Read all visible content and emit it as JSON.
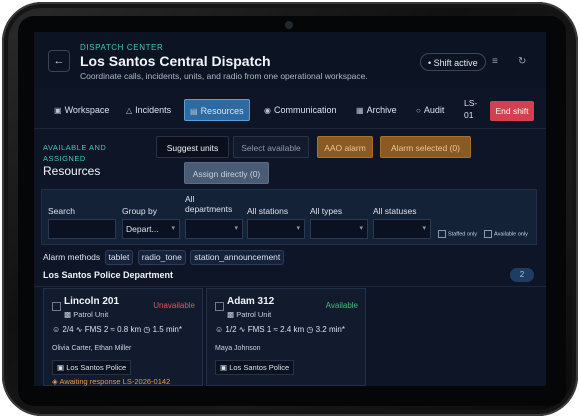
{
  "header": {
    "eyebrow": "DISPATCH CENTER",
    "title": "Los Santos Central Dispatch",
    "subtitle": "Coordinate calls, incidents, units, and radio from one operational workspace.",
    "shift_label": "Shift active"
  },
  "tabs": [
    {
      "label": "Workspace",
      "icon": "workspace-icon"
    },
    {
      "label": "Incidents",
      "icon": "incidents-icon"
    },
    {
      "label": "Resources",
      "icon": "resources-icon",
      "active": true
    },
    {
      "label": "Communication",
      "icon": "communication-icon"
    },
    {
      "label": "Archive",
      "icon": "archive-icon"
    },
    {
      "label": "Audit",
      "icon": "audit-icon"
    }
  ],
  "org_code": {
    "line1": "LS-",
    "line2": "01"
  },
  "end_shift_label": "End shift",
  "resources": {
    "eyebrow_line1": "AVAILABLE AND",
    "eyebrow_line2": "ASSIGNED",
    "title": "Resources",
    "actions": {
      "suggest": "Suggest units",
      "select_available": "Select available",
      "aao_alarm": "AAO alarm",
      "alarm_selected": "Alarm selected (0)",
      "assign_directly": "Assign directly (0)"
    }
  },
  "filters": {
    "search_label": "Search",
    "search_value": "",
    "group_by_label": "Group by",
    "group_by_value": "Depart...",
    "departments_label_line1": "All",
    "departments_label_line2": "departments",
    "departments_value": "",
    "stations_label": "All stations",
    "stations_value": "",
    "types_label": "All types",
    "types_value": "",
    "statuses_label": "All statuses",
    "statuses_value": "",
    "staffed_only": "Staffed only",
    "available_only": "Available only"
  },
  "alarm_methods": {
    "label": "Alarm methods",
    "chips": [
      "tablet",
      "radio_tone",
      "station_announcement"
    ]
  },
  "department": {
    "name": "Los Santos Police Department",
    "count": "2"
  },
  "units": [
    {
      "name": "Lincoln 201",
      "type": "Patrol Unit",
      "status": "Unavailable",
      "crew": "2/4",
      "fms": "FMS 2",
      "distance": "0.8 km",
      "eta": "1.5 min*",
      "people": "Olivia Carter, Ethan Miller",
      "station": "Los Santos Police",
      "awaiting": "Awaiting response LS-2026-0142"
    },
    {
      "name": "Adam 312",
      "type": "Patrol Unit",
      "status": "Available",
      "crew": "1/2",
      "fms": "FMS 1",
      "distance": "2.4 km",
      "eta": "3.2 min*",
      "people": "Maya Johnson",
      "station": "Los Santos Police",
      "awaiting": ""
    }
  ],
  "colors": {
    "accent": "#3ec8b8",
    "active_tab": "#2d6aa1",
    "end_shift": "#d2414f",
    "aao": "#8a5a22",
    "unavailable": "#e2545f",
    "available": "#3fbf7f",
    "awaiting": "#e59a4a"
  }
}
